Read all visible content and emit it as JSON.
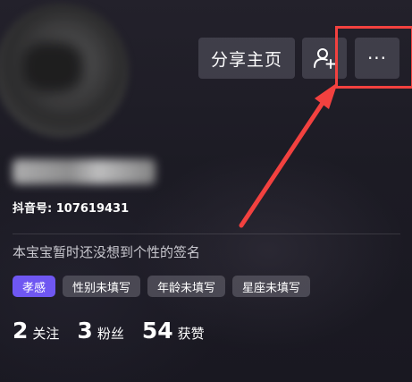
{
  "profile": {
    "account_id": "抖音号: 107619431",
    "signature": "本宝宝暂时还没想到个性的签名"
  },
  "actions": {
    "share_label": "分享主页",
    "follow_icon": "add-friend-icon",
    "more_label": "···"
  },
  "tags": [
    {
      "label": "孝感"
    },
    {
      "label": "性别未填写"
    },
    {
      "label": "年龄未填写"
    },
    {
      "label": "星座未填写"
    }
  ],
  "stats": [
    {
      "value": "2",
      "label": "关注"
    },
    {
      "value": "3",
      "label": "粉丝"
    },
    {
      "value": "54",
      "label": "获赞"
    }
  ],
  "colors": {
    "background": "#1d1c25",
    "location_tag": "#6f57f2",
    "annotation": "#f2413f"
  }
}
